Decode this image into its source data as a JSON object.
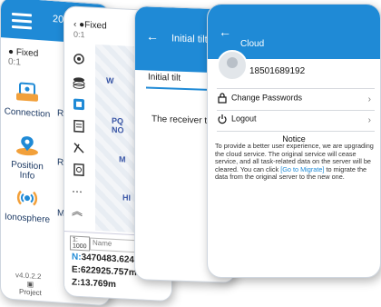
{
  "screen1": {
    "title_partial": "202",
    "fixed": "Fixed",
    "fixed_sub": "0:1",
    "tiles": [
      {
        "label": "Connection",
        "icon": "connection-icon"
      },
      {
        "label": "Position Info",
        "icon": "position-info-icon"
      },
      {
        "label": "Ionosphere",
        "icon": "ionosphere-icon"
      }
    ],
    "tiles_partial": [
      "Ro",
      "Rep",
      "M"
    ],
    "footer": "v4.0.2.2",
    "project_label": "Project"
  },
  "screen2": {
    "fixed": "Fixed",
    "fixed_sub": "0:1",
    "markers": [
      "W",
      "PQ NO",
      "M",
      "HI"
    ],
    "scale": "1:\n1000",
    "name_placeholder": "Name",
    "coords": {
      "n_label": "N:",
      "n_value": "3470483.624m",
      "e_label": "E:",
      "e_value": "622925.757m",
      "z_label": "Z:",
      "z_value": "13.769m"
    },
    "tools": [
      "layers-icon",
      "survey-icon",
      "document-icon",
      "compass-icon",
      "file-search-icon",
      "more-icon",
      "chevron-up-icon"
    ]
  },
  "screen3": {
    "title": "Initial tilt",
    "tab_label": "Initial tilt",
    "message": "The receiver turn"
  },
  "screen4": {
    "title": "Cloud",
    "phone": "18501689192",
    "menu": [
      {
        "label": "Change Passwords"
      },
      {
        "label": "Logout"
      }
    ],
    "notice_title": "Notice",
    "notice_text_1": "To provide a better user experience, we are upgrading the cloud service. The original service will cease service, and all task-related data on the server will be cleared. You can click ",
    "notice_link": "[Go to Migrate]",
    "notice_text_2": " to migrate the data from the original server to the new one.",
    "colors": {
      "primary": "#1f8ad6"
    }
  }
}
